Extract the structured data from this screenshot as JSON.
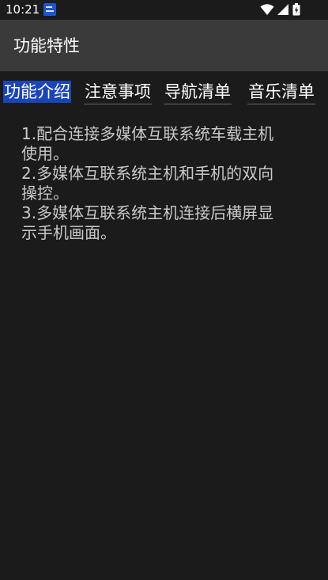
{
  "status_bar": {
    "time": "10:21",
    "notification_icon": "app-notification-icon",
    "icons": [
      "wifi-icon",
      "signal-icon",
      "battery-icon"
    ]
  },
  "app_bar": {
    "title": "功能特性"
  },
  "tabs": [
    {
      "label": "功能介绍",
      "active": true
    },
    {
      "label": "注意事项",
      "active": false
    },
    {
      "label": "导航清单",
      "active": false
    },
    {
      "label": "音乐清单",
      "active": false
    }
  ],
  "content": {
    "lines": [
      "1.配合连接多媒体互联系统车载主机",
      "使用。",
      "2.多媒体互联系统主机和手机的双向",
      "操控。",
      "3.多媒体互联系统主机连接后横屏显",
      "示手机画面。"
    ]
  },
  "colors": {
    "background": "#1b1b1b",
    "app_bar": "#3a3a3a",
    "active_tab": "#1b45b6",
    "content_text": "#c9c9c9"
  }
}
